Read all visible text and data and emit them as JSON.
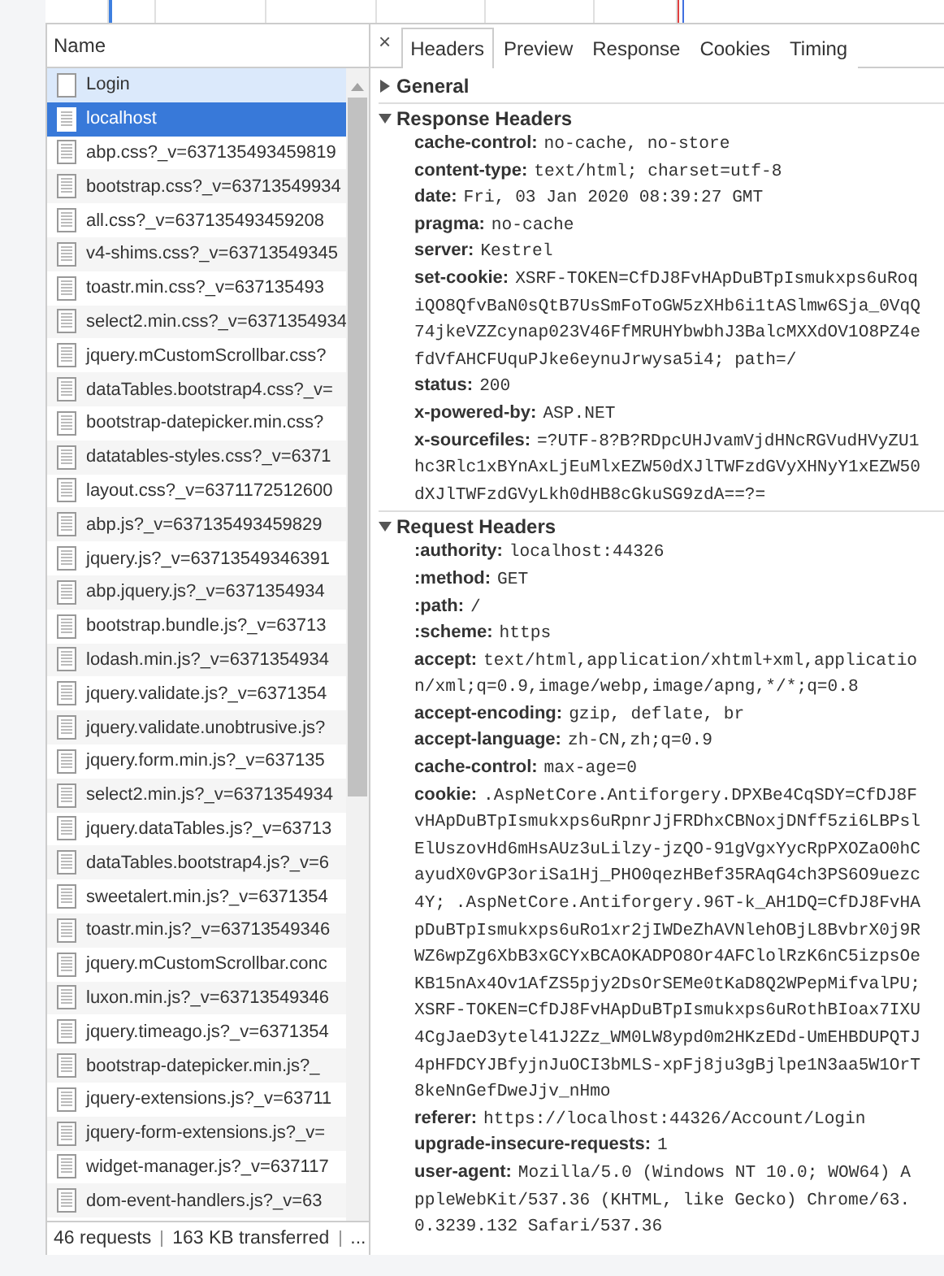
{
  "requests": {
    "column": "Name",
    "rows": [
      {
        "name": "Login",
        "kind": "blank",
        "selected": false,
        "hovered": true
      },
      {
        "name": "localhost",
        "kind": "document",
        "selected": true,
        "hovered": false
      },
      {
        "name": "abp.css?_v=637135493459819",
        "kind": "document",
        "selected": false,
        "hovered": false
      },
      {
        "name": "bootstrap.css?_v=63713549934",
        "kind": "document",
        "selected": false,
        "hovered": false
      },
      {
        "name": "all.css?_v=637135493459208",
        "kind": "document",
        "selected": false,
        "hovered": false
      },
      {
        "name": "v4-shims.css?_v=63713549345",
        "kind": "document",
        "selected": false,
        "hovered": false
      },
      {
        "name": "toastr.min.css?_v=637135493",
        "kind": "document",
        "selected": false,
        "hovered": false
      },
      {
        "name": "select2.min.css?_v=6371354934",
        "kind": "document",
        "selected": false,
        "hovered": false
      },
      {
        "name": "jquery.mCustomScrollbar.css?",
        "kind": "document",
        "selected": false,
        "hovered": false
      },
      {
        "name": "dataTables.bootstrap4.css?_v=",
        "kind": "document",
        "selected": false,
        "hovered": false
      },
      {
        "name": "bootstrap-datepicker.min.css?",
        "kind": "document",
        "selected": false,
        "hovered": false
      },
      {
        "name": "datatables-styles.css?_v=6371",
        "kind": "document",
        "selected": false,
        "hovered": false
      },
      {
        "name": "layout.css?_v=6371172512600",
        "kind": "document",
        "selected": false,
        "hovered": false
      },
      {
        "name": "abp.js?_v=637135493459829",
        "kind": "document",
        "selected": false,
        "hovered": false
      },
      {
        "name": "jquery.js?_v=63713549346391",
        "kind": "document",
        "selected": false,
        "hovered": false
      },
      {
        "name": "abp.jquery.js?_v=6371354934",
        "kind": "document",
        "selected": false,
        "hovered": false
      },
      {
        "name": "bootstrap.bundle.js?_v=63713",
        "kind": "document",
        "selected": false,
        "hovered": false
      },
      {
        "name": "lodash.min.js?_v=6371354934",
        "kind": "document",
        "selected": false,
        "hovered": false
      },
      {
        "name": "jquery.validate.js?_v=6371354",
        "kind": "document",
        "selected": false,
        "hovered": false
      },
      {
        "name": "jquery.validate.unobtrusive.js?",
        "kind": "document",
        "selected": false,
        "hovered": false
      },
      {
        "name": "jquery.form.min.js?_v=637135",
        "kind": "document",
        "selected": false,
        "hovered": false
      },
      {
        "name": "select2.min.js?_v=6371354934",
        "kind": "document",
        "selected": false,
        "hovered": false
      },
      {
        "name": "jquery.dataTables.js?_v=63713",
        "kind": "document",
        "selected": false,
        "hovered": false
      },
      {
        "name": "dataTables.bootstrap4.js?_v=6",
        "kind": "document",
        "selected": false,
        "hovered": false
      },
      {
        "name": "sweetalert.min.js?_v=6371354",
        "kind": "document",
        "selected": false,
        "hovered": false
      },
      {
        "name": "toastr.min.js?_v=63713549346",
        "kind": "document",
        "selected": false,
        "hovered": false
      },
      {
        "name": "jquery.mCustomScrollbar.conc",
        "kind": "document",
        "selected": false,
        "hovered": false
      },
      {
        "name": "luxon.min.js?_v=63713549346",
        "kind": "document",
        "selected": false,
        "hovered": false
      },
      {
        "name": "jquery.timeago.js?_v=6371354",
        "kind": "document",
        "selected": false,
        "hovered": false
      },
      {
        "name": "bootstrap-datepicker.min.js?_",
        "kind": "document",
        "selected": false,
        "hovered": false
      },
      {
        "name": "jquery-extensions.js?_v=63711",
        "kind": "document",
        "selected": false,
        "hovered": false
      },
      {
        "name": "jquery-form-extensions.js?_v=",
        "kind": "document",
        "selected": false,
        "hovered": false
      },
      {
        "name": "widget-manager.js?_v=637117",
        "kind": "document",
        "selected": false,
        "hovered": false
      },
      {
        "name": "dom-event-handlers.js?_v=63",
        "kind": "document",
        "selected": false,
        "hovered": false
      }
    ],
    "status": [
      "46 requests",
      "163 KB transferred",
      "..."
    ]
  },
  "details": {
    "close": "×",
    "tabs": [
      {
        "label": "Headers",
        "selected": true
      },
      {
        "label": "Preview",
        "selected": false
      },
      {
        "label": "Response",
        "selected": false
      },
      {
        "label": "Cookies",
        "selected": false
      },
      {
        "label": "Timing",
        "selected": false
      }
    ],
    "sections": [
      {
        "title": "General",
        "expanded": false
      },
      {
        "title": "Response Headers",
        "expanded": true,
        "headers": [
          {
            "name": "cache-control:",
            "value_lines": [
              "no-cache, no-store"
            ]
          },
          {
            "name": "content-type:",
            "value_lines": [
              "text/html; charset=utf-8"
            ]
          },
          {
            "name": "date:",
            "value_lines": [
              "Fri, 03 Jan 2020 08:39:27 GMT"
            ]
          },
          {
            "name": "pragma:",
            "value_lines": [
              "no-cache"
            ]
          },
          {
            "name": "server:",
            "value_lines": [
              "Kestrel"
            ]
          },
          {
            "name": "set-cookie:",
            "value_lines": [
              "XSRF-TOKEN=CfDJ8FvHApDuBTpIsmukxps6uRoq",
              "iQO8QfvBaN0sQtB7UsSmFoToGW5zXHb6i1tASlmw6Sja_0VqQ",
              "74jkeVZZcynap023V46FfMRUHYbwbhJ3BalcMXXdOV1O8PZ4e",
              "fdVfAHCFUquPJke6eynuJrwysa5i4; path=/"
            ]
          },
          {
            "name": "status:",
            "value_lines": [
              "200"
            ]
          },
          {
            "name": "x-powered-by:",
            "value_lines": [
              "ASP.NET"
            ]
          },
          {
            "name": "x-sourcefiles:",
            "value_lines": [
              "=?UTF-8?B?RDpcUHJvamVjdHNcRGVudHVyZU1",
              "hc3Rlc1xBYnAxLjEuMlxEZW50dXJlTWFzdGVyXHNyY1xEZW50",
              "dXJlTWFzdGVyLkh0dHB8cGkuSG9zdA==?="
            ]
          }
        ]
      },
      {
        "title": "Request Headers",
        "expanded": true,
        "headers": [
          {
            "name": ":authority:",
            "value_lines": [
              "localhost:44326"
            ]
          },
          {
            "name": ":method:",
            "value_lines": [
              "GET"
            ]
          },
          {
            "name": ":path:",
            "value_lines": [
              "/"
            ]
          },
          {
            "name": ":scheme:",
            "value_lines": [
              "https"
            ]
          },
          {
            "name": "accept:",
            "value_lines": [
              "text/html,application/xhtml+xml,applicatio",
              "n/xml;q=0.9,image/webp,image/apng,*/*;q=0.8"
            ]
          },
          {
            "name": "accept-encoding:",
            "value_lines": [
              "gzip, deflate, br"
            ]
          },
          {
            "name": "accept-language:",
            "value_lines": [
              "zh-CN,zh;q=0.9"
            ]
          },
          {
            "name": "cache-control:",
            "value_lines": [
              "max-age=0"
            ]
          },
          {
            "name": "cookie:",
            "value_lines": [
              ".AspNetCore.Antiforgery.DPXBe4CqSDY=CfDJ8F",
              "vHApDuBTpIsmukxps6uRpnrJjFRDhxCBNoxjDNff5zi6LBPsl",
              "ElUszovHd6mHsAUz3uLilzy-jzQO-91gVgxYycRpPXOZaO0hC",
              "ayudX0vGP3oriSa1Hj_PHO0qezHBef35RAqG4ch3PS6O9uezc",
              "4Y; .AspNetCore.Antiforgery.96T-k_AH1DQ=CfDJ8FvHA",
              "pDuBTpIsmukxps6uRo1xr2jIWDeZhAVNlehOBjL8BvbrX0j9R",
              "WZ6wpZg6XbB3xGCYxBCAOKADPO8Or4AFClolRzK6nC5izpsOe",
              "KB15nAx4Ov1AfZS5pjy2DsOrSEMe0tKaD8Q2WPepMifvalPU;",
              "XSRF-TOKEN=CfDJ8FvHApDuBTpIsmukxps6uRothBIoax7IXU",
              "4CgJaeD3ytel41J2Zz_WM0LW8ypd0m2HKzEDd-UmEHBDUPQTJ",
              "4pHFDCYJBfyjnJuOCI3bMLS-xpFj8ju3gBjlpe1N3aa5W1OrT",
              "8keNnGefDweJjv_nHmo"
            ]
          },
          {
            "name": "referer:",
            "value_lines": [
              "https://localhost:44326/Account/Login"
            ]
          },
          {
            "name": "upgrade-insecure-requests:",
            "value_lines": [
              "1"
            ]
          },
          {
            "name": "user-agent:",
            "value_lines": [
              "Mozilla/5.0 (Windows NT 10.0; WOW64) A",
              "ppleWebKit/537.36 (KHTML, like Gecko) Chrome/63.",
              "0.3239.132 Safari/537.36"
            ]
          }
        ]
      }
    ]
  }
}
